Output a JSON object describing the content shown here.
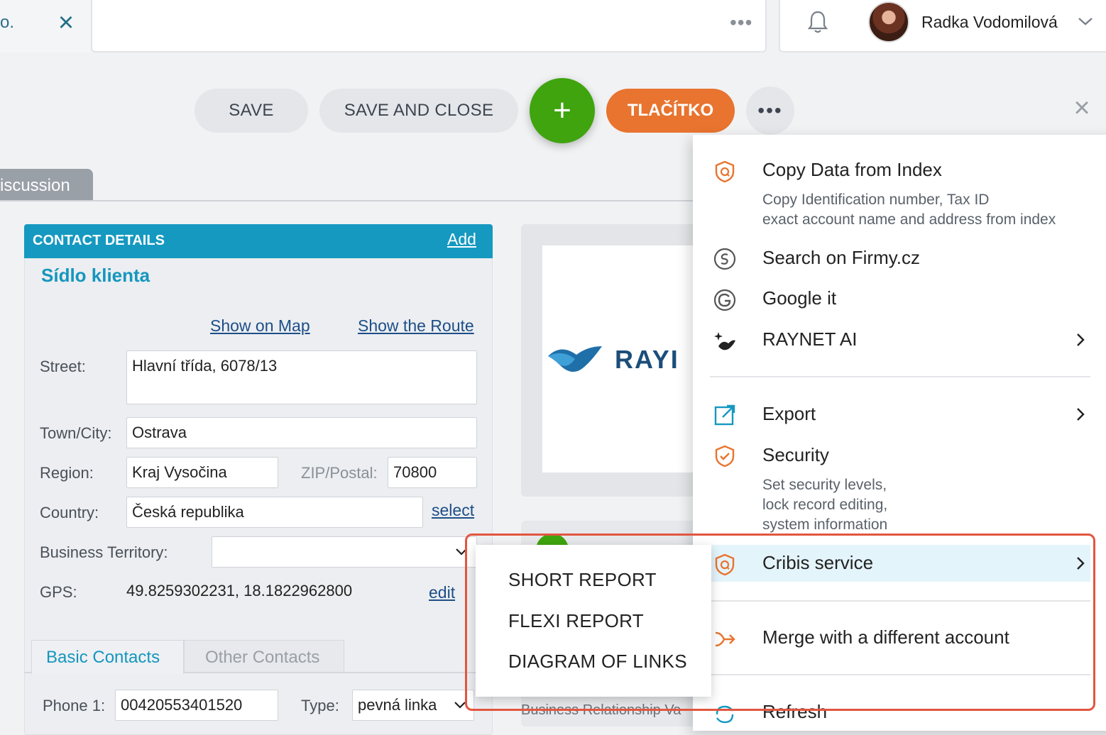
{
  "top": {
    "tab_text": "o.",
    "user_name": "Radka Vodomilová"
  },
  "toolbar": {
    "save": "SAVE",
    "save_close": "SAVE AND CLOSE",
    "plus": "+",
    "tlacitko": "TLAČÍTKO",
    "more": "•••"
  },
  "discussion_tab": "iscussion",
  "contact": {
    "header": "CONTACT DETAILS",
    "add": "Add",
    "address_name": "Sídlo klienta",
    "show_on_map": "Show on Map",
    "show_route": "Show the Route",
    "street_label": "Street:",
    "street_value": "Hlavní třída, 6078/13",
    "city_label": "Town/City:",
    "city_value": "Ostrava",
    "region_label": "Region:",
    "region_value": "Kraj Vysočina",
    "zip_label": "ZIP/Postal:",
    "zip_value": "70800",
    "country_label": "Country:",
    "country_value": "Česká republika",
    "country_select": "select",
    "territory_label": "Business Territory:",
    "territory_value": "",
    "gps_label": "GPS:",
    "gps_value": "49.8259302231, 18.1822962800",
    "gps_edit": "edit",
    "tabs": [
      "Basic Contacts",
      "Other Contacts"
    ],
    "phone_label": "Phone 1:",
    "phone_value": "00420553401520",
    "type_label": "Type:",
    "type_value": "pevná linka"
  },
  "logo": {
    "text": "RAYI"
  },
  "business_relationship": "Business Relationship Va",
  "menu": {
    "copy_title": "Copy Data from Index",
    "copy_desc_1": "Copy Identification number, Tax ID",
    "copy_desc_2": "exact account name and address from index",
    "firmy": "Search on Firmy.cz",
    "google": "Google it",
    "ai": "RAYNET AI",
    "export": "Export",
    "security_title": "Security",
    "security_desc_1": "Set security levels,",
    "security_desc_2": "lock record editing,",
    "security_desc_3": "system information",
    "cribis": "Cribis service",
    "merge": "Merge with a different account",
    "refresh": "Refresh"
  },
  "submenu": {
    "items": [
      "SHORT REPORT",
      "FLEXI REPORT",
      "DIAGRAM OF LINKS"
    ]
  },
  "colors": {
    "accent_blue": "#1599c0",
    "green": "#3fa40e",
    "orange": "#e8742f",
    "highlight_red": "#e2563f"
  }
}
